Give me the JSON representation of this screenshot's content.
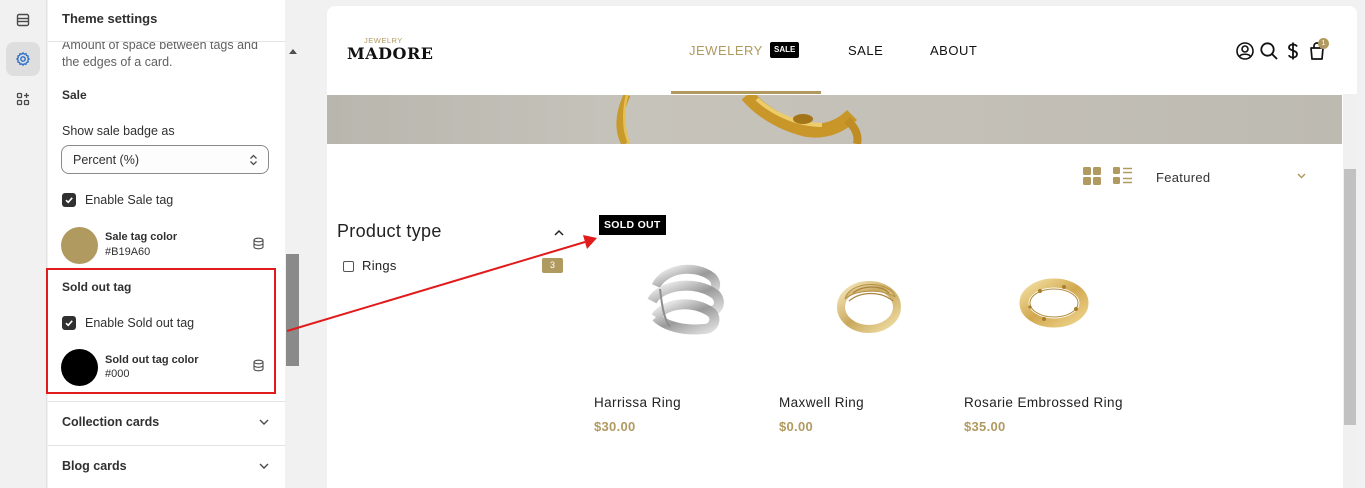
{
  "panel": {
    "title": "Theme settings",
    "help_text": "Amount of space between tags and the edges of a card.",
    "sale_section_title": "Sale",
    "sale_badge_label": "Show sale badge as",
    "sale_badge_value": "Percent (%)",
    "enable_sale_tag_label": "Enable Sale tag",
    "enable_sale_tag_checked": true,
    "sale_tag_color_label": "Sale tag color",
    "sale_tag_color_value": "#B19A60",
    "soldout_section_title": "Sold out tag",
    "enable_soldout_label": "Enable Sold out tag",
    "enable_soldout_checked": true,
    "soldout_color_label": "Sold out tag color",
    "soldout_color_value": "#000",
    "collection_cards_label": "Collection cards",
    "blog_cards_label": "Blog cards"
  },
  "store": {
    "logo_small": "JEWELRY",
    "logo_big": "MADORE",
    "nav": [
      {
        "label": "JEWELERY",
        "active": true,
        "badge": "SALE"
      },
      {
        "label": "SALE",
        "active": false
      },
      {
        "label": "ABOUT",
        "active": false
      }
    ],
    "cart_count": "1",
    "sort_label": "Featured",
    "filter_title": "Product type",
    "filter_option": "Rings",
    "filter_count": "3",
    "sold_out_badge": "SOLD OUT",
    "products": [
      {
        "name": "Harrissa Ring",
        "price": "$30.00",
        "variant": "silver"
      },
      {
        "name": "Maxwell Ring",
        "price": "$0.00",
        "variant": "gold-dome"
      },
      {
        "name": "Rosarie Embrossed Ring",
        "price": "$35.00",
        "variant": "gold-textured"
      }
    ]
  },
  "colors": {
    "accent": "#B19A60",
    "highlight": "#E11B1B",
    "soldout": "#000000"
  }
}
